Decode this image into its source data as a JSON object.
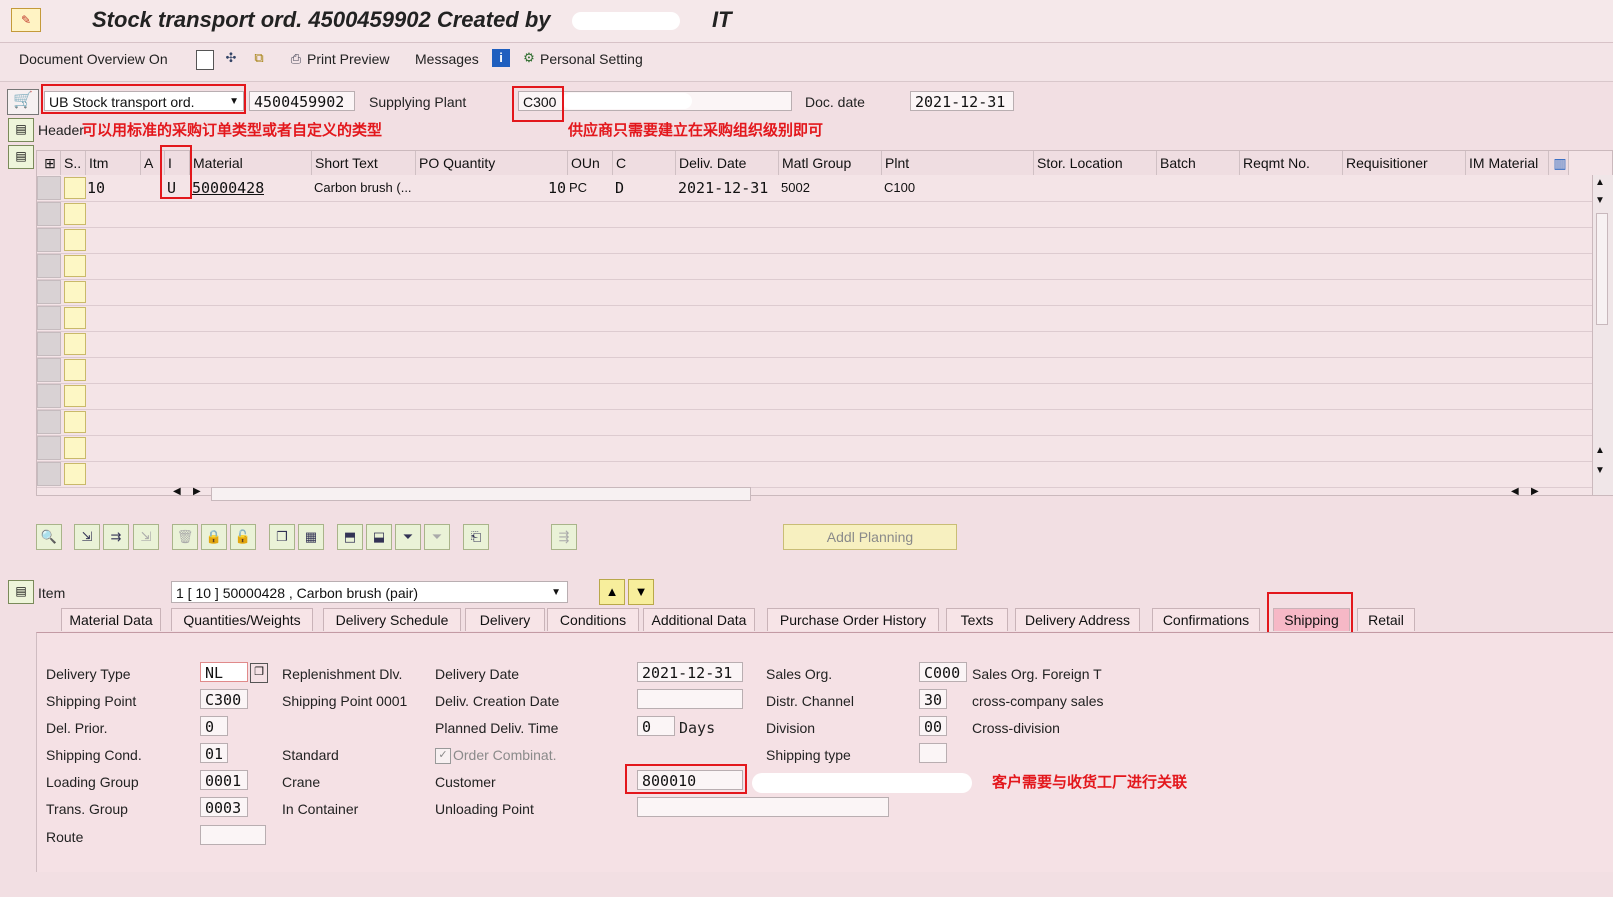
{
  "window": {
    "title": "Stock transport ord. 4500459902 Created by",
    "title_suffix": "IT"
  },
  "toolbar": {
    "doc_overview": "Document Overview On",
    "print_preview": "Print Preview",
    "messages": "Messages",
    "personal_setting": "Personal Setting"
  },
  "header": {
    "order_type": "UB Stock transport ord.",
    "po_number": "4500459902",
    "supplying_plant_label": "Supplying Plant",
    "supplying_plant_value": "C300",
    "doc_date_label": "Doc. date",
    "doc_date_value": "2021-12-31",
    "header_label": "Header"
  },
  "annotations": {
    "note_type": "可以用标准的采购订单类型或者自定义的类型",
    "note_vendor": "供应商只需要建立在采购组织级别即可",
    "note_customer": "客户需要与收货工厂进行关联"
  },
  "grid": {
    "columns": [
      "S..",
      "Itm",
      "A",
      "I",
      "Material",
      "Short Text",
      "PO Quantity",
      "OUn",
      "C",
      "Deliv. Date",
      "Matl Group",
      "Plnt",
      "Stor. Location",
      "Batch",
      "Reqmt No.",
      "Requisitioner",
      "IM Material"
    ],
    "rows": [
      {
        "itm": "10",
        "a": "",
        "i": "U",
        "material": "50000428",
        "short_text": "Carbon brush (...",
        "po_qty": "10",
        "oun": "PC",
        "c": "D",
        "deliv_date": "2021-12-31",
        "matl_group": "5002",
        "plnt": "C100"
      }
    ]
  },
  "buttons": {
    "addl_planning": "Addl Planning"
  },
  "item_bar": {
    "label": "Item",
    "selected": "1 [ 10 ] 50000428 , Carbon brush (pair)"
  },
  "tabs": [
    "Material Data",
    "Quantities/Weights",
    "Delivery Schedule",
    "Delivery",
    "Conditions",
    "Additional Data",
    "Purchase Order History",
    "Texts",
    "Delivery Address",
    "Confirmations",
    "Shipping",
    "Retail"
  ],
  "shipping": {
    "delivery_type_label": "Delivery Type",
    "delivery_type": "NL",
    "shipping_point_label": "Shipping Point",
    "shipping_point": "C300",
    "del_prior_label": "Del. Prior.",
    "del_prior": "0",
    "shipping_cond_label": "Shipping Cond.",
    "shipping_cond": "01",
    "loading_group_label": "Loading Group",
    "loading_group": "0001",
    "trans_group_label": "Trans. Group",
    "trans_group": "0003",
    "route_label": "Route",
    "route": "",
    "replenishment_label": "Replenishment Dlv.",
    "shipping_point_desc": "Shipping Point 0001",
    "shipping_cond_desc": "Standard",
    "loading_group_desc": "Crane",
    "trans_group_desc": "In Container",
    "delivery_date_label": "Delivery Date",
    "delivery_date": "2021-12-31",
    "deliv_creation_label": "Deliv. Creation Date",
    "deliv_creation": "",
    "planned_time_label": "Planned Deliv. Time",
    "planned_time": "0",
    "planned_unit": "Days",
    "order_combinat_label": "Order Combinat.",
    "customer_label": "Customer",
    "customer": "800010",
    "unloading_point_label": "Unloading Point",
    "unloading_point": "",
    "sales_org_label": "Sales Org.",
    "sales_org": "C000",
    "sales_org_desc": "Sales Org. Foreign T",
    "distr_channel_label": "Distr. Channel",
    "distr_channel": "30",
    "distr_channel_desc": "cross-company sales",
    "division_label": "Division",
    "division": "00",
    "division_desc": "Cross-division",
    "shipping_type_label": "Shipping type",
    "shipping_type": ""
  }
}
